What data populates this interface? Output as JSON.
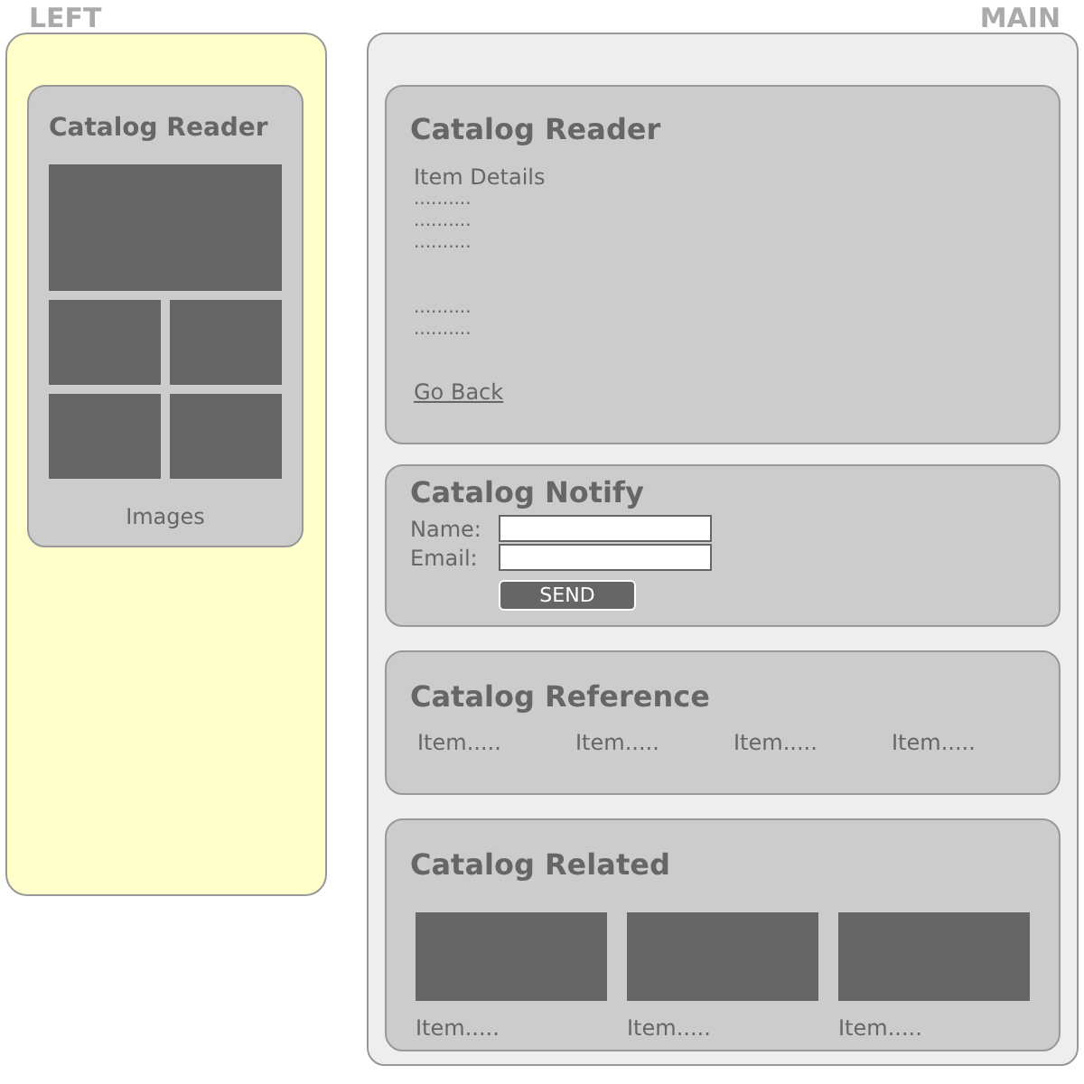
{
  "left": {
    "label": "LEFT",
    "card": {
      "title": "Catalog Reader",
      "caption": "Images"
    }
  },
  "main": {
    "label": "MAIN",
    "reader": {
      "title": "Catalog Reader",
      "heading": "Item Details",
      "lines": [
        "..........",
        "..........",
        ".........."
      ],
      "lines_2": [
        "..........",
        ".........."
      ],
      "link": "Go Back"
    },
    "notify": {
      "title": "Catalog Notify",
      "fields": [
        {
          "label": "Name:"
        },
        {
          "label": "Email:"
        }
      ],
      "button": "SEND"
    },
    "reference": {
      "title": "Catalog Reference",
      "items": [
        "Item.....",
        "Item.....",
        "Item.....",
        "Item....."
      ]
    },
    "related": {
      "title": "Catalog Related",
      "items": [
        "Item.....",
        "Item.....",
        "Item....."
      ]
    }
  }
}
